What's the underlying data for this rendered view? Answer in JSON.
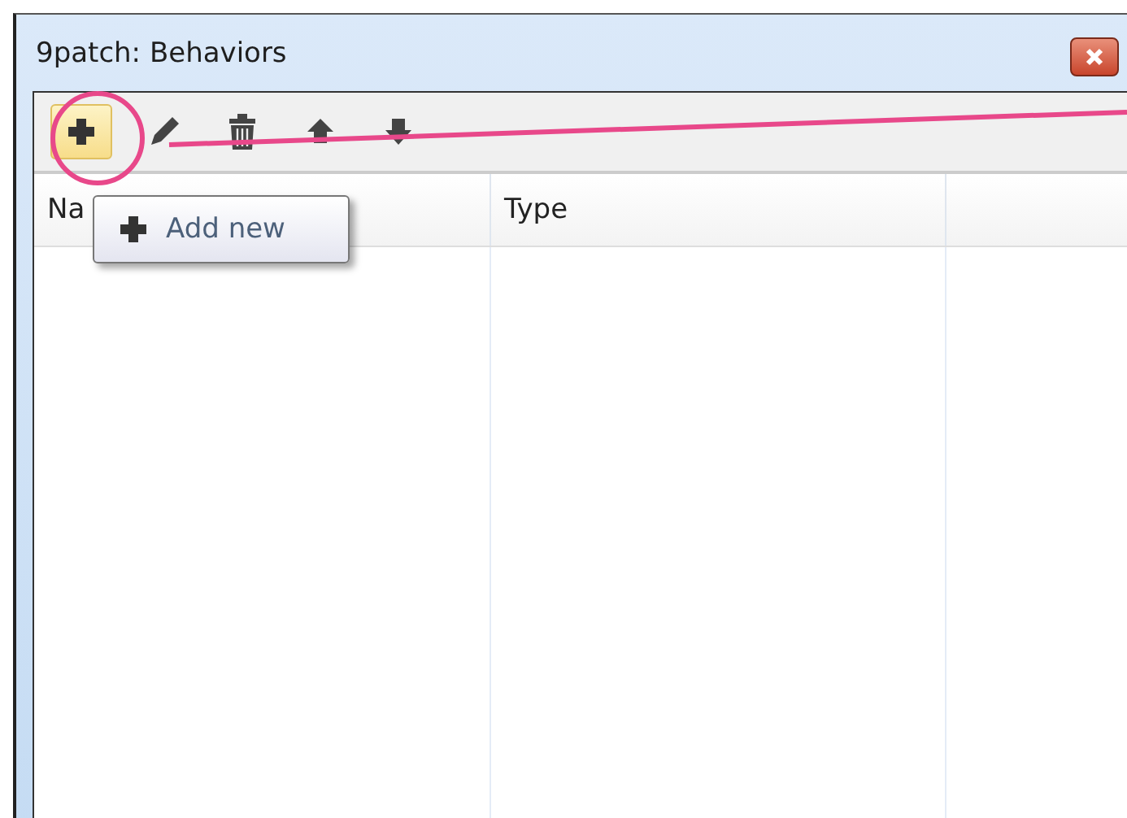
{
  "window": {
    "title": "9patch: Behaviors"
  },
  "toolbar": [
    {
      "kind": "add",
      "hovered": true
    },
    {
      "kind": "edit",
      "hovered": false
    },
    {
      "kind": "delete",
      "hovered": false
    },
    {
      "kind": "up",
      "hovered": false
    },
    {
      "kind": "down",
      "hovered": false
    }
  ],
  "tooltip": {
    "text": "Add new"
  },
  "table": {
    "columns": [
      {
        "label": "Na"
      },
      {
        "label": "Type"
      }
    ]
  }
}
